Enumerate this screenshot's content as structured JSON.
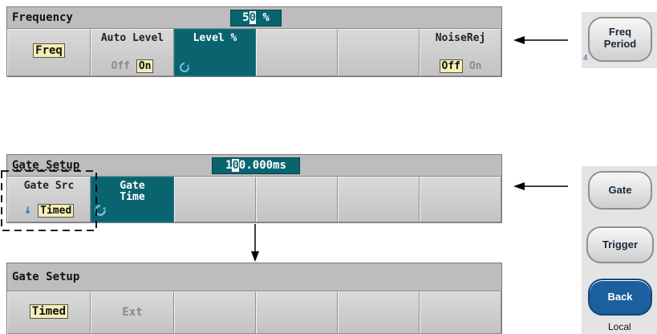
{
  "panel1": {
    "title": "Frequency",
    "value_prefix": "5",
    "value_cursor": "0",
    "value_suffix": " %",
    "softkeys": {
      "freq": "Freq",
      "auto_level": {
        "label": "Auto Level",
        "off": "Off",
        "on": "On"
      },
      "level_pct": "Level %",
      "noiserej": {
        "label": "NoiseRej",
        "off": "Off",
        "on": "On"
      }
    }
  },
  "panel2": {
    "title": "Gate Setup",
    "value_prefix": "1",
    "value_cursor": "0",
    "value_suffix": "0.000ms",
    "softkeys": {
      "gate_src": {
        "label": "Gate Src",
        "value": "Timed"
      },
      "gate_time": {
        "line1": "Gate",
        "line2": "Time"
      }
    }
  },
  "panel3": {
    "title": "Gate Setup",
    "softkeys": {
      "timed": "Timed",
      "ext": "Ext"
    }
  },
  "hardware_keys": {
    "freq_period": {
      "line1": "Freq",
      "line2": "Period",
      "number": "4"
    },
    "gate": "Gate",
    "trigger": "Trigger",
    "back": "Back",
    "local": "Local"
  },
  "colors": {
    "active_softkey": "#0a6470",
    "highlight": "#f6efb5",
    "back_key": "#1b5f9e"
  }
}
